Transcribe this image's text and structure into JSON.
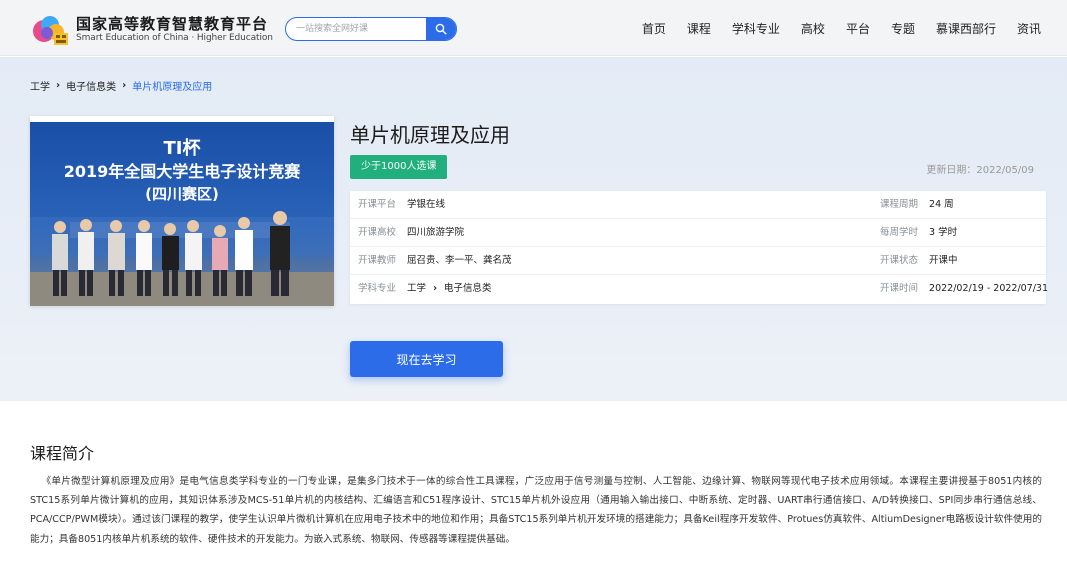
{
  "header": {
    "logo_cn": "国家高等教育智慧教育平台",
    "logo_en": "Smart Education of China · Higher Education",
    "search_placeholder": "一站搜索全网好课",
    "nav": [
      "首页",
      "课程",
      "学科专业",
      "高校",
      "平台",
      "专题",
      "慕课西部行",
      "资讯"
    ]
  },
  "breadcrumb": [
    "工学",
    "电子信息类",
    "单片机原理及应用"
  ],
  "cover": {
    "line1": "TI杯",
    "line2": "2019年全国大学生电子设计竞赛",
    "line3": "(四川赛区)"
  },
  "course": {
    "title": "单片机原理及应用",
    "badge": "少于1000人选课",
    "update_date": "更新日期：2022/05/09"
  },
  "info": {
    "platform_label": "开课平台",
    "platform": "学银在线",
    "school_label": "开课高校",
    "school": "四川旅游学院",
    "teachers_label": "开课教师",
    "teachers": "屈召贵、李一平、龚名茂",
    "subject_label": "学科专业",
    "subject_1": "工学",
    "subject_2": "电子信息类",
    "period_label": "课程周期",
    "period": "24 周",
    "weekly_label": "每周学时",
    "weekly": "3 学时",
    "status_label": "开课状态",
    "status": "开课中",
    "time_label": "开课时间",
    "time": "2022/02/19 - 2022/07/31"
  },
  "actions": {
    "study": "现在去学习"
  },
  "intro": {
    "title": "课程简介",
    "text": "《单片微型计算机原理及应用》是电气信息类学科专业的一门专业课，是集多门技术于一体的综合性工具课程，广泛应用于信号测量与控制、人工智能、边缘计算、物联网等现代电子技术应用领域。本课程主要讲授基于8051内核的STC15系列单片微计算机的应用，其知识体系涉及MCS-51单片机的内核结构、汇编语言和C51程序设计、STC15单片机外设应用（通用输入输出接口、中断系统、定时器、UART串行通信接口、A/D转换接口、SPI同步串行通信总线、PCA/CCP/PWM模块）。通过该门课程的教学，使学生认识单片微机计算机在应用电子技术中的地位和作用；具备STC15系列单片机开发环境的搭建能力；具备Keil程序开发软件、Protues仿真软件、AltiumDesigner电路板设计软件使用的能力；具备8051内核单片机系统的软件、硬件技术的开发能力。为嵌入式系统、物联网、传感器等课程提供基础。"
  },
  "colors": {
    "primary": "#2d6ce8",
    "badge_green": "#21b07d",
    "hero_bg": "#e5ecf6"
  }
}
